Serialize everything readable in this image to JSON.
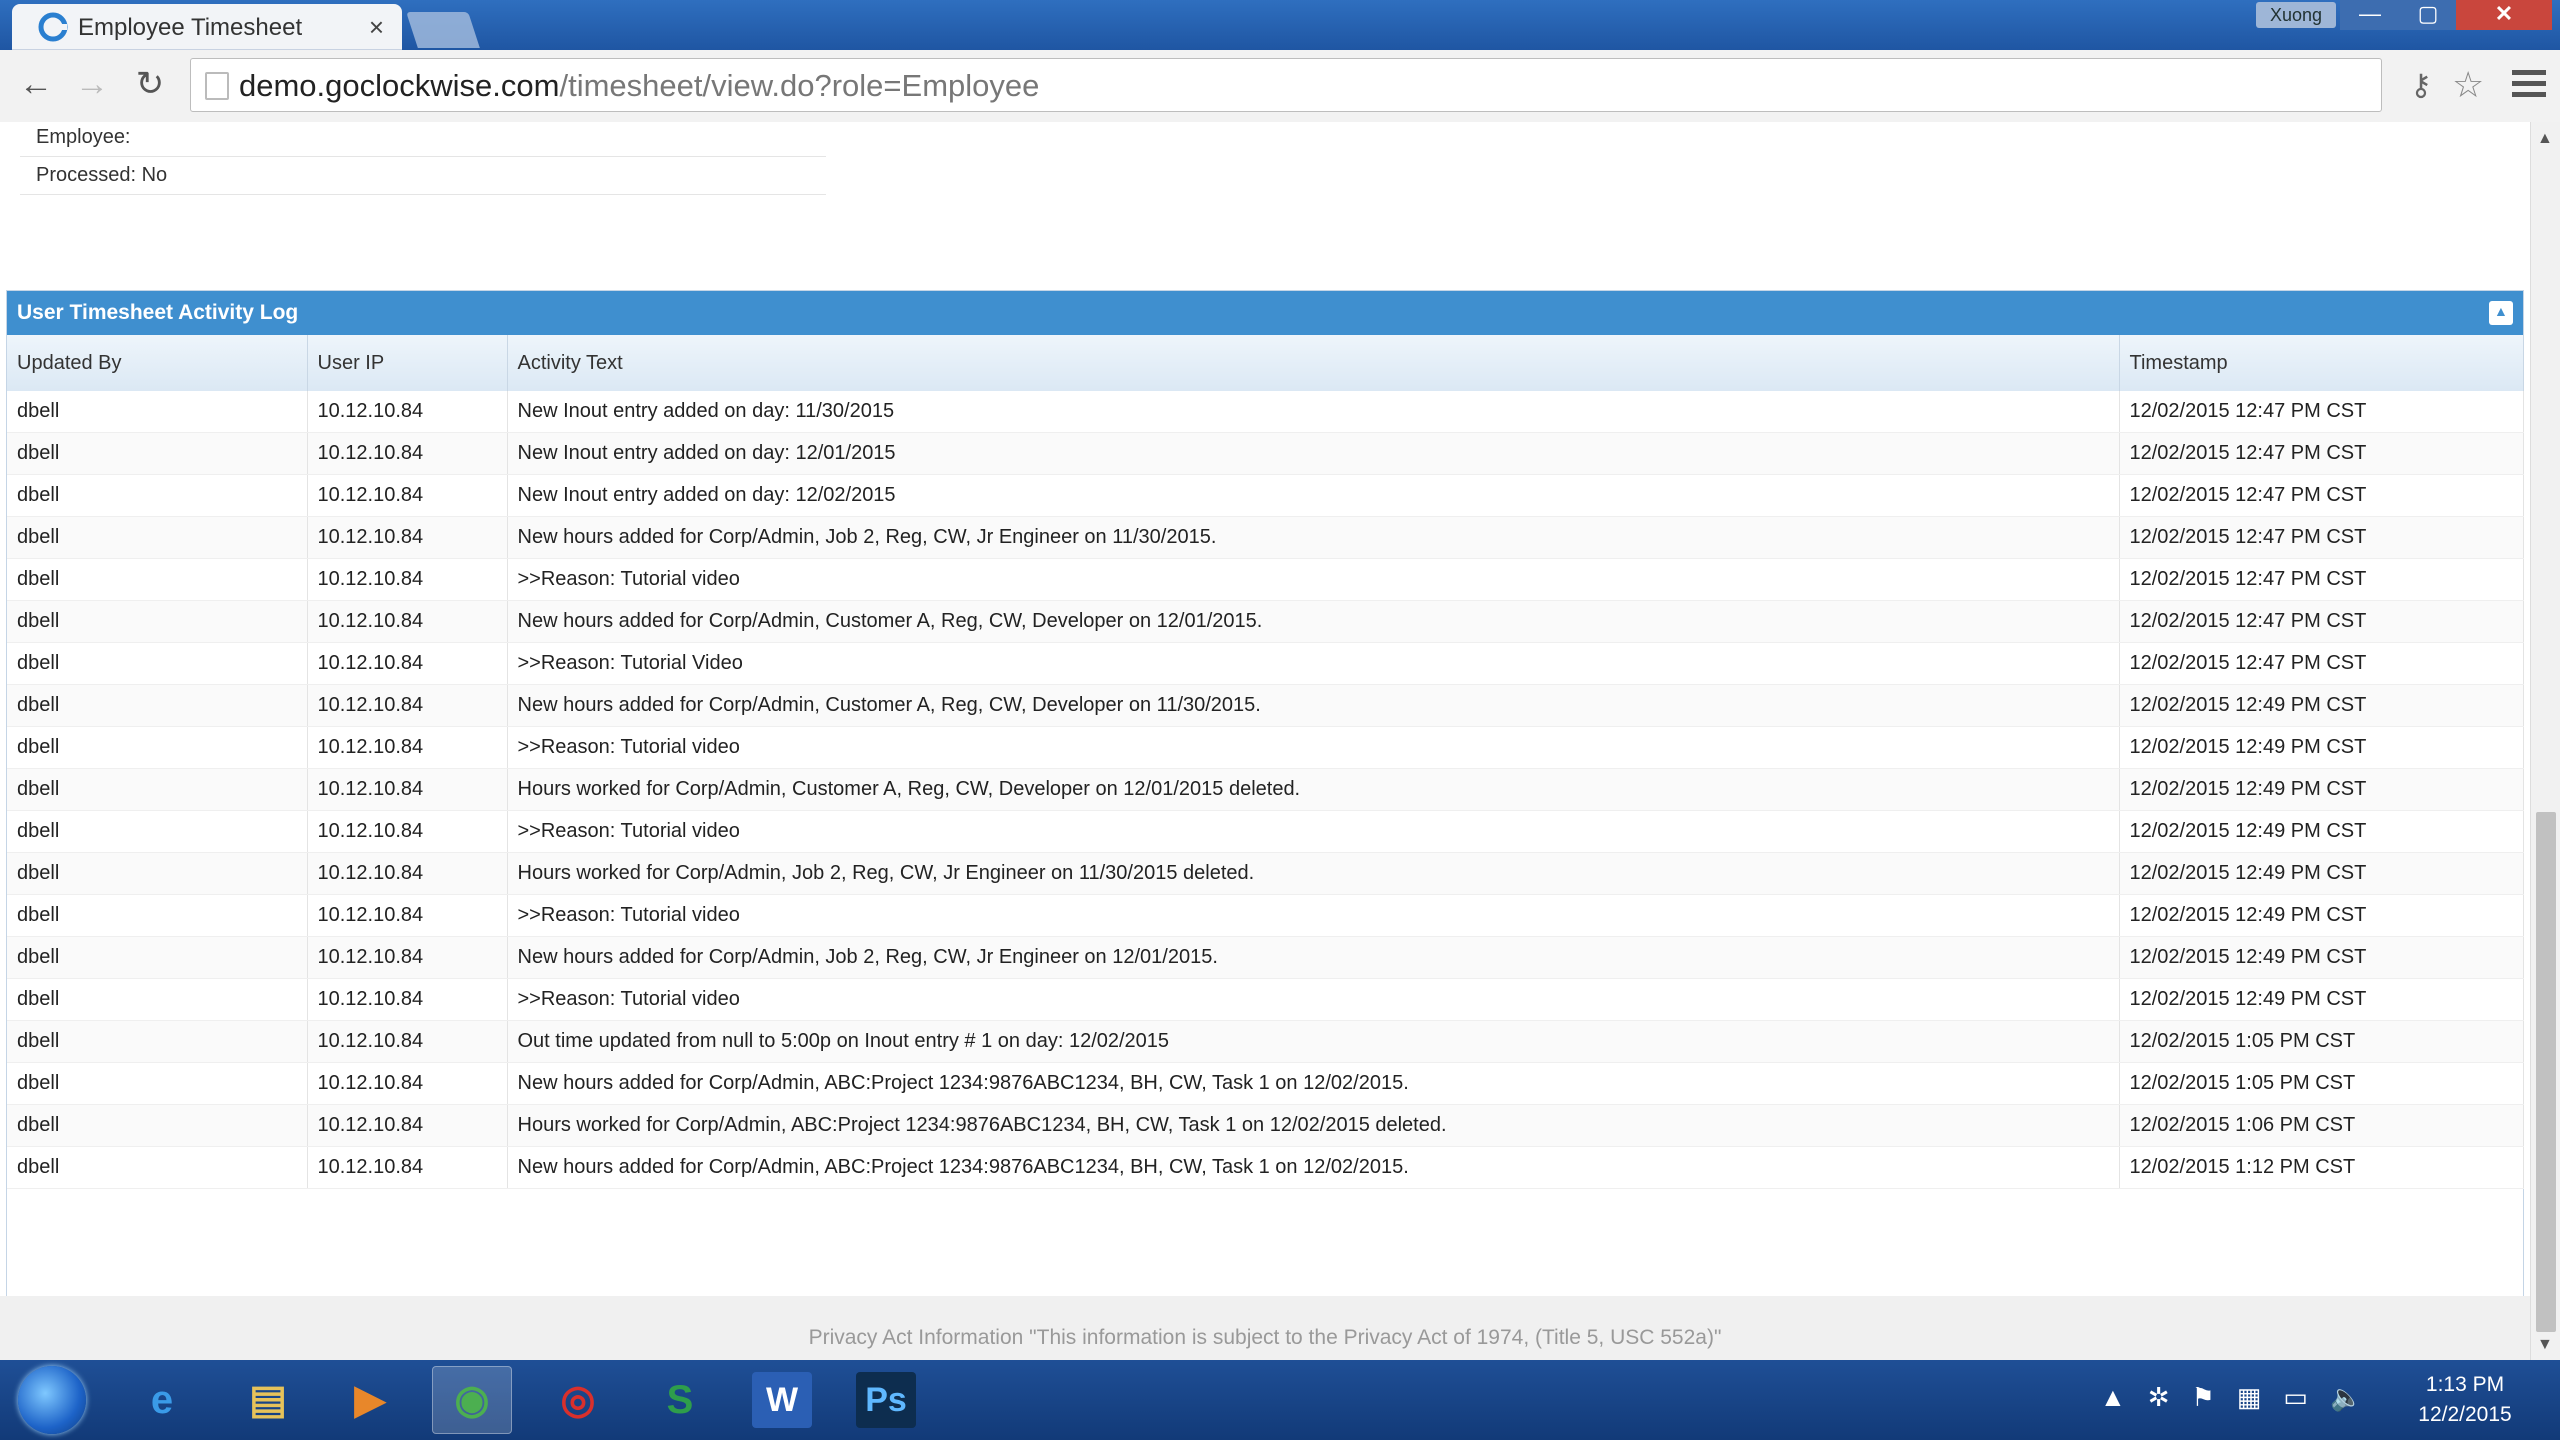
{
  "browser": {
    "tab_title": "Employee Timesheet",
    "tab_close": "×",
    "profile_label": "Xuong",
    "url_host": "demo.goclockwise.com",
    "url_path": "/timesheet/view.do?role=Employee",
    "back_icon": "←",
    "forward_icon": "→",
    "reload_icon": "↻",
    "min_glyph": "—",
    "max_glyph": "▢",
    "close_glyph": "✕",
    "key_glyph": "⚷",
    "star_glyph": "☆"
  },
  "employee_info": {
    "employee_label": "Employee:",
    "processed_label": "Processed: No"
  },
  "activity_log": {
    "title": "User Timesheet Activity Log",
    "columns": [
      "Updated By",
      "User IP",
      "Activity Text",
      "Timestamp"
    ],
    "rows": [
      [
        "dbell",
        "10.12.10.84",
        "New Inout entry added on day: 11/30/2015",
        "12/02/2015 12:47 PM CST"
      ],
      [
        "dbell",
        "10.12.10.84",
        "New Inout entry added on day: 12/01/2015",
        "12/02/2015 12:47 PM CST"
      ],
      [
        "dbell",
        "10.12.10.84",
        "New Inout entry added on day: 12/02/2015",
        "12/02/2015 12:47 PM CST"
      ],
      [
        "dbell",
        "10.12.10.84",
        "New hours added for Corp/Admin, Job 2, Reg, CW, Jr Engineer on 11/30/2015.",
        "12/02/2015 12:47 PM CST"
      ],
      [
        "dbell",
        "10.12.10.84",
        ">>Reason: Tutorial video",
        "12/02/2015 12:47 PM CST"
      ],
      [
        "dbell",
        "10.12.10.84",
        "New hours added for Corp/Admin, Customer A, Reg, CW, Developer on 12/01/2015.",
        "12/02/2015 12:47 PM CST"
      ],
      [
        "dbell",
        "10.12.10.84",
        ">>Reason: Tutorial Video",
        "12/02/2015 12:47 PM CST"
      ],
      [
        "dbell",
        "10.12.10.84",
        "New hours added for Corp/Admin, Customer A, Reg, CW, Developer on 11/30/2015.",
        "12/02/2015 12:49 PM CST"
      ],
      [
        "dbell",
        "10.12.10.84",
        ">>Reason: Tutorial video",
        "12/02/2015 12:49 PM CST"
      ],
      [
        "dbell",
        "10.12.10.84",
        "Hours worked for Corp/Admin, Customer A, Reg, CW, Developer on 12/01/2015 deleted.",
        "12/02/2015 12:49 PM CST"
      ],
      [
        "dbell",
        "10.12.10.84",
        ">>Reason: Tutorial video",
        "12/02/2015 12:49 PM CST"
      ],
      [
        "dbell",
        "10.12.10.84",
        "Hours worked for Corp/Admin, Job 2, Reg, CW, Jr Engineer on 11/30/2015 deleted.",
        "12/02/2015 12:49 PM CST"
      ],
      [
        "dbell",
        "10.12.10.84",
        ">>Reason: Tutorial video",
        "12/02/2015 12:49 PM CST"
      ],
      [
        "dbell",
        "10.12.10.84",
        "New hours added for Corp/Admin, Job 2, Reg, CW, Jr Engineer on 12/01/2015.",
        "12/02/2015 12:49 PM CST"
      ],
      [
        "dbell",
        "10.12.10.84",
        ">>Reason: Tutorial video",
        "12/02/2015 12:49 PM CST"
      ],
      [
        "dbell",
        "10.12.10.84",
        "Out time updated from null to 5:00p on Inout entry # 1 on day: 12/02/2015",
        "12/02/2015 1:05 PM CST"
      ],
      [
        "dbell",
        "10.12.10.84",
        "New hours added for Corp/Admin, ABC:Project 1234:9876ABC1234, BH, CW, Task 1 on 12/02/2015.",
        "12/02/2015 1:05 PM CST"
      ],
      [
        "dbell",
        "10.12.10.84",
        "Hours worked for Corp/Admin, ABC:Project 1234:9876ABC1234, BH, CW, Task 1 on 12/02/2015 deleted.",
        "12/02/2015 1:06 PM CST"
      ],
      [
        "dbell",
        "10.12.10.84",
        "New hours added for Corp/Admin, ABC:Project 1234:9876ABC1234, BH, CW, Task 1 on 12/02/2015.",
        "12/02/2015 1:12 PM CST"
      ]
    ]
  },
  "footer": {
    "privacy_text": "Privacy Act Information \"This information is subject to the Privacy Act of 1974, (Title 5, USC 552a)\""
  },
  "taskbar": {
    "apps": [
      {
        "name": "internet-explorer-icon",
        "glyph": "e",
        "color": "#3a9be8"
      },
      {
        "name": "file-explorer-icon",
        "glyph": "▤",
        "color": "#e6c25a"
      },
      {
        "name": "media-player-icon",
        "glyph": "▶",
        "color": "#e8872a"
      },
      {
        "name": "chrome-icon",
        "glyph": "◉",
        "color": "#4caf50"
      },
      {
        "name": "creative-cloud-icon",
        "glyph": "◎",
        "color": "#d9302c"
      },
      {
        "name": "snagit-icon",
        "glyph": "S",
        "color": "#2e9e4b"
      },
      {
        "name": "word-icon",
        "glyph": "W",
        "color": "#2b5fb4"
      },
      {
        "name": "photoshop-icon",
        "glyph": "Ps",
        "color": "#0d2d4f"
      }
    ],
    "tray_icons": [
      "▲",
      "✲",
      "⚑",
      "▦",
      "▭",
      "🔈"
    ],
    "time": "1:13 PM",
    "date": "12/2/2015"
  }
}
